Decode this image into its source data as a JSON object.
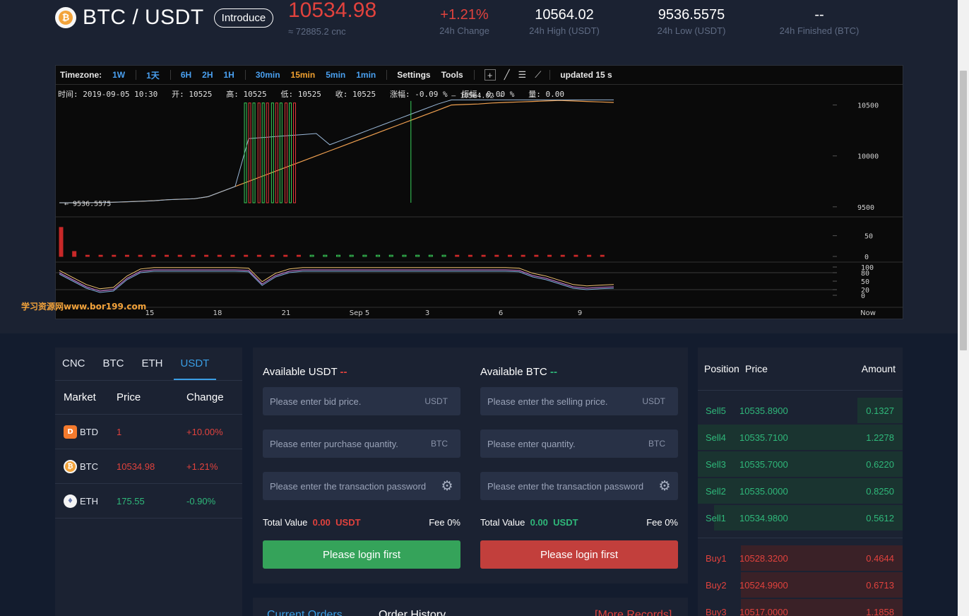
{
  "header": {
    "coin_glyph": "₿",
    "pair": "BTC / USDT",
    "introduce": "Introduce",
    "last_price": "10534.98",
    "last_cny": "≈ 72885.2 cnc",
    "stats": [
      {
        "value": "+1.21%",
        "label": "24h Change",
        "color": "#e1423d"
      },
      {
        "value": "10564.02",
        "label": "24h High (USDT)"
      },
      {
        "value": "9536.5575",
        "label": "24h Low (USDT)"
      },
      {
        "value": "--",
        "label": "24h Finished (BTC)"
      }
    ]
  },
  "chart_toolbar": {
    "timezone": "Timezone:",
    "intervals": [
      "1W",
      "1天",
      "6H",
      "2H",
      "1H",
      "30min",
      "15min",
      "5min",
      "1min"
    ],
    "active_interval": "15min",
    "settings": "Settings",
    "tools": "Tools",
    "tool_icons": [
      "crosshair-icon",
      "line-icon",
      "horizontal-lines-icon",
      "fan-icon"
    ],
    "updated": "updated 15 s"
  },
  "chart_ohlc": "时间: 2019-09-05 10:30   开: 10525   高: 10525   低: 10525   收: 10525   涨幅: -0.09 %   振幅: 0.00 %   量: 0.00",
  "chart_data": {
    "type": "line",
    "price_axis": [
      "10500",
      "10000",
      "9500"
    ],
    "volume_axis": [
      "50",
      "0"
    ],
    "indicator_axis": [
      "100",
      "80",
      "50",
      "20",
      "0"
    ],
    "x_ticks": [
      "15",
      "18",
      "21",
      "Sep 5",
      "3",
      "6",
      "9",
      "Now"
    ],
    "price_ylim": [
      9450,
      10560
    ],
    "price_series": [
      9540,
      9540,
      9540,
      9542,
      9545,
      9550,
      9555,
      9560,
      9570,
      9575,
      9580,
      9600,
      9650,
      9700,
      9750,
      9800,
      9850,
      9900,
      9950,
      10000,
      10050,
      10100,
      10150,
      10200,
      10250,
      10300,
      10350,
      10400,
      10450,
      10500,
      10505,
      10510,
      10520,
      10525,
      10530,
      10535,
      10540,
      10545,
      10540,
      10535,
      10530,
      10525
    ],
    "high_label": "10564.02",
    "low_label": "9536.5575",
    "volume_series": [
      70,
      12,
      3,
      3,
      3,
      3,
      3,
      3,
      3,
      3,
      3,
      3,
      3,
      3,
      3,
      3,
      3,
      3,
      3,
      3,
      3,
      3,
      3,
      3,
      3,
      3,
      3,
      3,
      3,
      3,
      3,
      3,
      3,
      3,
      3,
      3,
      3,
      3,
      3,
      3,
      3,
      3
    ],
    "indicator_series": [
      80,
      55,
      30,
      15,
      20,
      60,
      85,
      90,
      90,
      90,
      90,
      90,
      90,
      90,
      88,
      40,
      70,
      85,
      90,
      90,
      90,
      90,
      90,
      90,
      90,
      90,
      90,
      90,
      90,
      90,
      90,
      90,
      90,
      90,
      88,
      70,
      60,
      45,
      30,
      25,
      28,
      30
    ]
  },
  "watermark": "学习资源网www.bor199.com",
  "markets": {
    "tabs": [
      "CNC",
      "BTC",
      "ETH",
      "USDT"
    ],
    "active_tab": "USDT",
    "headers": [
      "Market",
      "Price",
      "Change"
    ],
    "rows": [
      {
        "coin": "BTD",
        "glyph": "D",
        "logo_color": "#f47a2d",
        "price": "1",
        "change": "+10.00%",
        "dir": "up"
      },
      {
        "coin": "BTC",
        "glyph": "₿",
        "logo_color": "#f2a33a",
        "price": "10534.98",
        "change": "+1.21%",
        "dir": "up"
      },
      {
        "coin": "ETH",
        "glyph": "♦",
        "logo_color": "#6a7bb0",
        "price": "175.55",
        "change": "-0.90%",
        "dir": "down"
      }
    ]
  },
  "trade": {
    "buy": {
      "available_label": "Available USDT",
      "available_value": "--",
      "price_placeholder": "Please enter bid price.",
      "price_unit": "USDT",
      "qty_placeholder": "Please enter purchase quantity.",
      "qty_unit": "BTC",
      "pwd_placeholder": "Please enter the transaction password",
      "total_label": "Total Value",
      "total_value": "0.00",
      "total_unit": "USDT",
      "fee": "Fee 0%",
      "button": "Please login first"
    },
    "sell": {
      "available_label": "Available BTC",
      "available_value": "--",
      "price_placeholder": "Please enter the selling price.",
      "price_unit": "USDT",
      "qty_placeholder": "Please enter quantity.",
      "qty_unit": "BTC",
      "pwd_placeholder": "Please enter the transaction password",
      "total_label": "Total Value",
      "total_value": "0.00",
      "total_unit": "USDT",
      "fee": "Fee 0%",
      "button": "Please login first"
    }
  },
  "orders_tabs": {
    "current": "Current Orders",
    "history": "Order History",
    "more": "[More Records]"
  },
  "order_book": {
    "headers": [
      "Position",
      "Price",
      "Amount"
    ],
    "sells": [
      {
        "pos": "Sell5",
        "price": "10535.8900",
        "amount": "0.1327",
        "depth": 0.22
      },
      {
        "pos": "Sell4",
        "price": "10535.7100",
        "amount": "1.2278",
        "depth": 1.0
      },
      {
        "pos": "Sell3",
        "price": "10535.7000",
        "amount": "0.6220",
        "depth": 1.0
      },
      {
        "pos": "Sell2",
        "price": "10535.0000",
        "amount": "0.8250",
        "depth": 1.0
      },
      {
        "pos": "Sell1",
        "price": "10534.9800",
        "amount": "0.5612",
        "depth": 0.92
      }
    ],
    "buys": [
      {
        "pos": "Buy1",
        "price": "10528.3200",
        "amount": "0.4644",
        "depth": 0.79
      },
      {
        "pos": "Buy2",
        "price": "10524.9900",
        "amount": "0.6713",
        "depth": 0.79
      },
      {
        "pos": "Buy3",
        "price": "10517.0000",
        "amount": "1.1858",
        "depth": 0.79
      }
    ]
  }
}
